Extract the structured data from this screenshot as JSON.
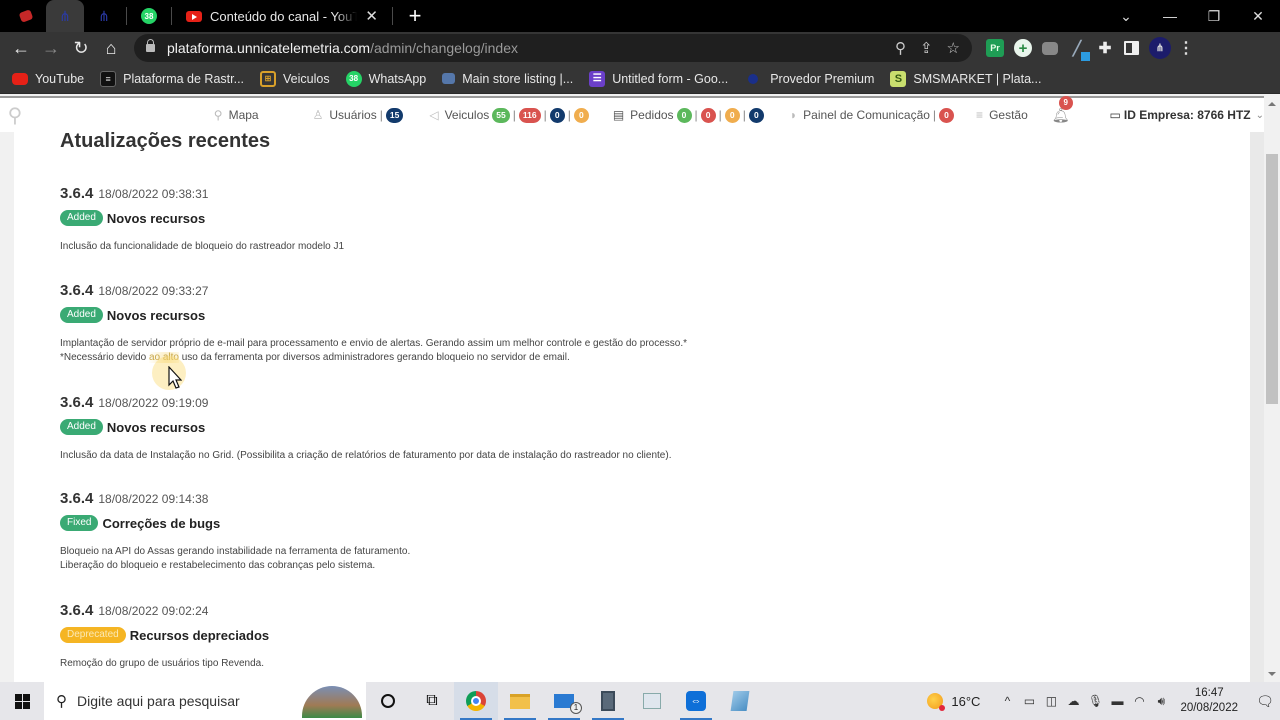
{
  "browser": {
    "tabs": [
      {
        "type": "pinned",
        "icon": "red-app-icon"
      },
      {
        "type": "pinned",
        "icon": "blue-network-icon",
        "active": true
      },
      {
        "type": "pinned",
        "icon": "blue-network-icon-2"
      },
      {
        "type": "pinned",
        "icon": "whatsapp-icon",
        "badge": "38"
      },
      {
        "type": "normal",
        "icon": "youtube-icon",
        "title": "Conteúdo do canal - YouTube Studio"
      }
    ],
    "new_tab_label": "+",
    "window_controls": {
      "tab_search": "⌄",
      "minimize": "—",
      "restore": "❐",
      "close": "✕"
    },
    "url_host": "plataforma.unnicatelemetria.com",
    "url_path": "/admin/changelog/index",
    "bookmarks": [
      {
        "icon": "youtube-icon",
        "label": "YouTube"
      },
      {
        "icon": "plataforma-icon",
        "label": "Plataforma de Rastr..."
      },
      {
        "icon": "veiculos-icon",
        "label": "Veiculos"
      },
      {
        "icon": "whatsapp-icon",
        "label": "WhatsApp",
        "badge": "38"
      },
      {
        "icon": "store-icon",
        "label": "Main store listing |..."
      },
      {
        "icon": "form-icon",
        "label": "Untitled form - Goo..."
      },
      {
        "icon": "globe-icon",
        "label": "Provedor Premium"
      },
      {
        "icon": "smsmarket-icon",
        "label": "SMSMARKET | Plata..."
      }
    ],
    "extensions": {
      "premiere": "Pr"
    }
  },
  "app_header": {
    "nav": {
      "mapa": "Mapa",
      "usuarios": {
        "label": "Usuários",
        "count": "15"
      },
      "veiculos": {
        "label": "Veiculos",
        "counts": [
          "55",
          "116",
          "0",
          "0"
        ]
      },
      "pedidos": {
        "label": "Pedidos",
        "counts": [
          "0",
          "0",
          "0",
          "0"
        ]
      },
      "painel": {
        "label": "Painel de Comunicação",
        "count": "0"
      },
      "gestao": "Gestão"
    },
    "notifications_count": "9",
    "empresa": "ID Empresa: 8766 HTZ"
  },
  "colors": {
    "added": "#3aaa74",
    "fixed": "#3aaa74",
    "deprecated": "#f5b523",
    "badge_navy": "#123a6c",
    "badge_green": "#5cb85c",
    "badge_red": "#d9534f",
    "badge_orange": "#f0ad4e"
  },
  "changelog": {
    "title": "Atualizações recentes",
    "entries": [
      {
        "version": "3.6.4",
        "date": "18/08/2022 09:38:31",
        "tag": "Added",
        "category": "Novos recursos",
        "lines": [
          "Inclusão da funcionalidade de bloqueio do rastreador modelo J1"
        ]
      },
      {
        "version": "3.6.4",
        "date": "18/08/2022 09:33:27",
        "tag": "Added",
        "category": "Novos recursos",
        "lines": [
          "Implantação de servidor próprio de e-mail para processamento e envio de alertas. Gerando assim um melhor controle e gestão do processo.*",
          "*Necessário devido ",
          "ao alto",
          " uso da ferramenta por diversos administradores gerando bloqueio no servidor de email."
        ]
      },
      {
        "version": "3.6.4",
        "date": "18/08/2022 09:19:09",
        "tag": "Added",
        "category": "Novos recursos",
        "lines": [
          "Inclusão da data de Instalação no Grid. (Possibilita a criação de relatórios de faturamento por data de instalação do rastreador no cliente)."
        ]
      },
      {
        "version": "3.6.4",
        "date": "18/08/2022 09:14:38",
        "tag": "Fixed",
        "category": "Correções de bugs",
        "lines": [
          "Bloqueio na API do Assas gerando instabilidade na ferramenta de faturamento.",
          "Liberação do bloqueio e restabelecimento das cobranças pelo sistema."
        ]
      },
      {
        "version": "3.6.4",
        "date": "18/08/2022 09:02:24",
        "tag": "Deprecated",
        "category": "Recursos depreciados",
        "lines": [
          "Remoção do grupo de usuários tipo Revenda."
        ]
      }
    ]
  },
  "taskbar": {
    "search_placeholder": "Digite aqui para pesquisar",
    "mail_badge": "1",
    "weather": "16°C",
    "time": "16:47",
    "date": "20/08/2022"
  }
}
